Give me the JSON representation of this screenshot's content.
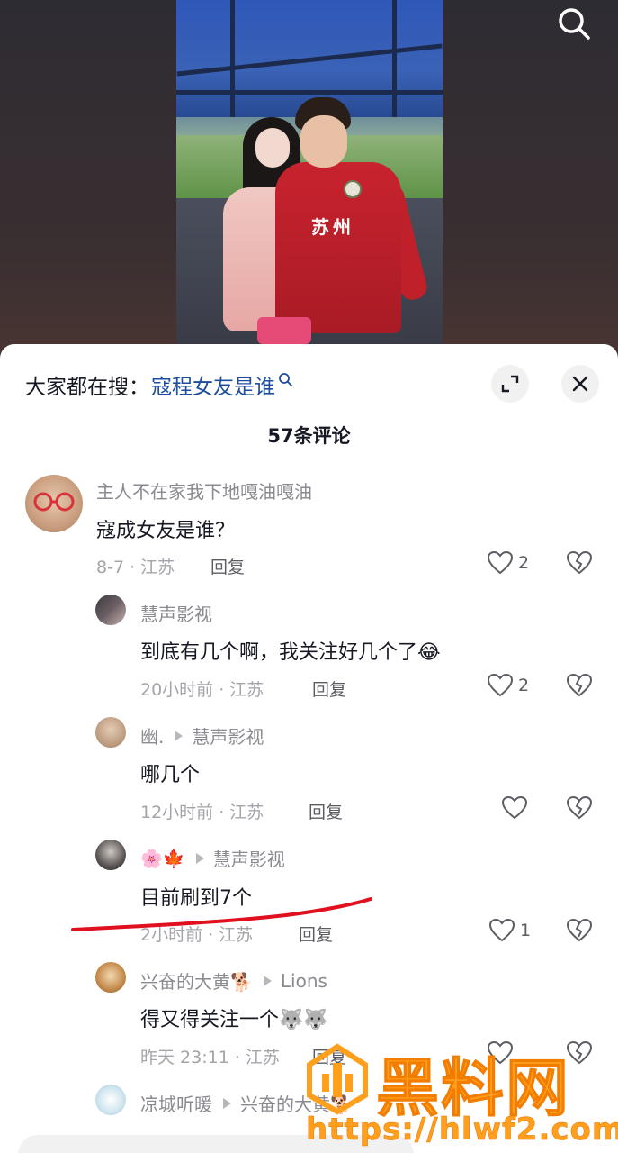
{
  "search": {
    "icon": "search-icon"
  },
  "video": {
    "shirt_text": "苏州"
  },
  "sheet": {
    "hot_search_prefix": "大家都在搜：",
    "hot_search_term": "寇程女友是谁",
    "comment_count_title": "57条评论"
  },
  "comments": [
    {
      "username": "主人不在家我下地嘎油嘎油",
      "text": "寇成女友是谁？",
      "time_location": "8-7 · 江苏",
      "reply_label": "回复",
      "likes": "2"
    },
    {
      "username": "慧声影视",
      "text": "到底有几个啊，我关注好几个了😂",
      "time_location": "20小时前 · 江苏",
      "reply_label": "回复",
      "likes": "2"
    },
    {
      "username": "幽.",
      "reply_to": "慧声影视",
      "text": "哪几个",
      "time_location": "12小时前 · 江苏",
      "reply_label": "回复",
      "likes": ""
    },
    {
      "username": "🌸🍁",
      "reply_to": "慧声影视",
      "text": "目前刷到7个",
      "time_location": "2小时前 · 江苏",
      "reply_label": "回复",
      "likes": "1"
    },
    {
      "username": "兴奋的大黄🐕",
      "reply_to": "Lions",
      "text": "得又得关注一个🐺🐺",
      "time_location": "昨天 23:11 · 江苏",
      "reply_label": "回复",
      "likes": ""
    },
    {
      "username": "凉城听暖",
      "reply_to": "兴奋的大黄🐕",
      "text": "",
      "time_location": "",
      "reply_label": "",
      "likes": ""
    }
  ],
  "watermark": {
    "title": "黑料网",
    "url": "https://hlwf2.com"
  },
  "colors": {
    "accent_link": "#1d4d9e",
    "annotation_red": "#e0101e",
    "watermark_orange": "#ff9f1c"
  }
}
